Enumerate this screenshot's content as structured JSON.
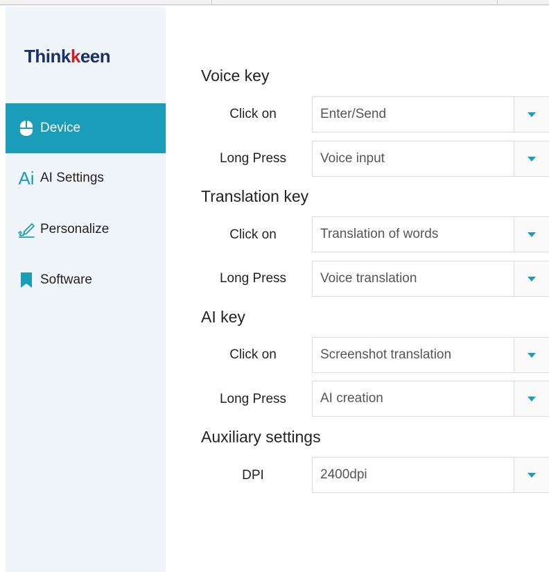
{
  "brand": {
    "logo_prefix": "Think",
    "logo_k": "k",
    "logo_suffix": "een",
    "accent_color": "#1a9db8",
    "logo_color": "#1b2f6b",
    "logo_k_color": "#d71920"
  },
  "sidebar": {
    "items": [
      {
        "label": "Device",
        "icon": "mouse-icon",
        "active": true
      },
      {
        "label": "AI Settings",
        "icon": "ai-icon",
        "active": false
      },
      {
        "label": "Personalize",
        "icon": "pen-icon",
        "active": false
      },
      {
        "label": "Software",
        "icon": "bookmark-icon",
        "active": false
      }
    ]
  },
  "sections": [
    {
      "title": "Voice key",
      "rows": [
        {
          "label": "Click on",
          "value": "Enter/Send"
        },
        {
          "label": "Long Press",
          "value": "Voice input"
        }
      ]
    },
    {
      "title": "Translation key",
      "rows": [
        {
          "label": "Click on",
          "value": "Translation of words"
        },
        {
          "label": "Long Press",
          "value": "Voice translation"
        }
      ]
    },
    {
      "title": "AI key",
      "rows": [
        {
          "label": "Click on",
          "value": "Screenshot translation"
        },
        {
          "label": "Long Press",
          "value": "AI creation"
        }
      ]
    },
    {
      "title": "Auxiliary settings",
      "rows": [
        {
          "label": "DPI",
          "value": "2400dpi"
        }
      ]
    }
  ]
}
